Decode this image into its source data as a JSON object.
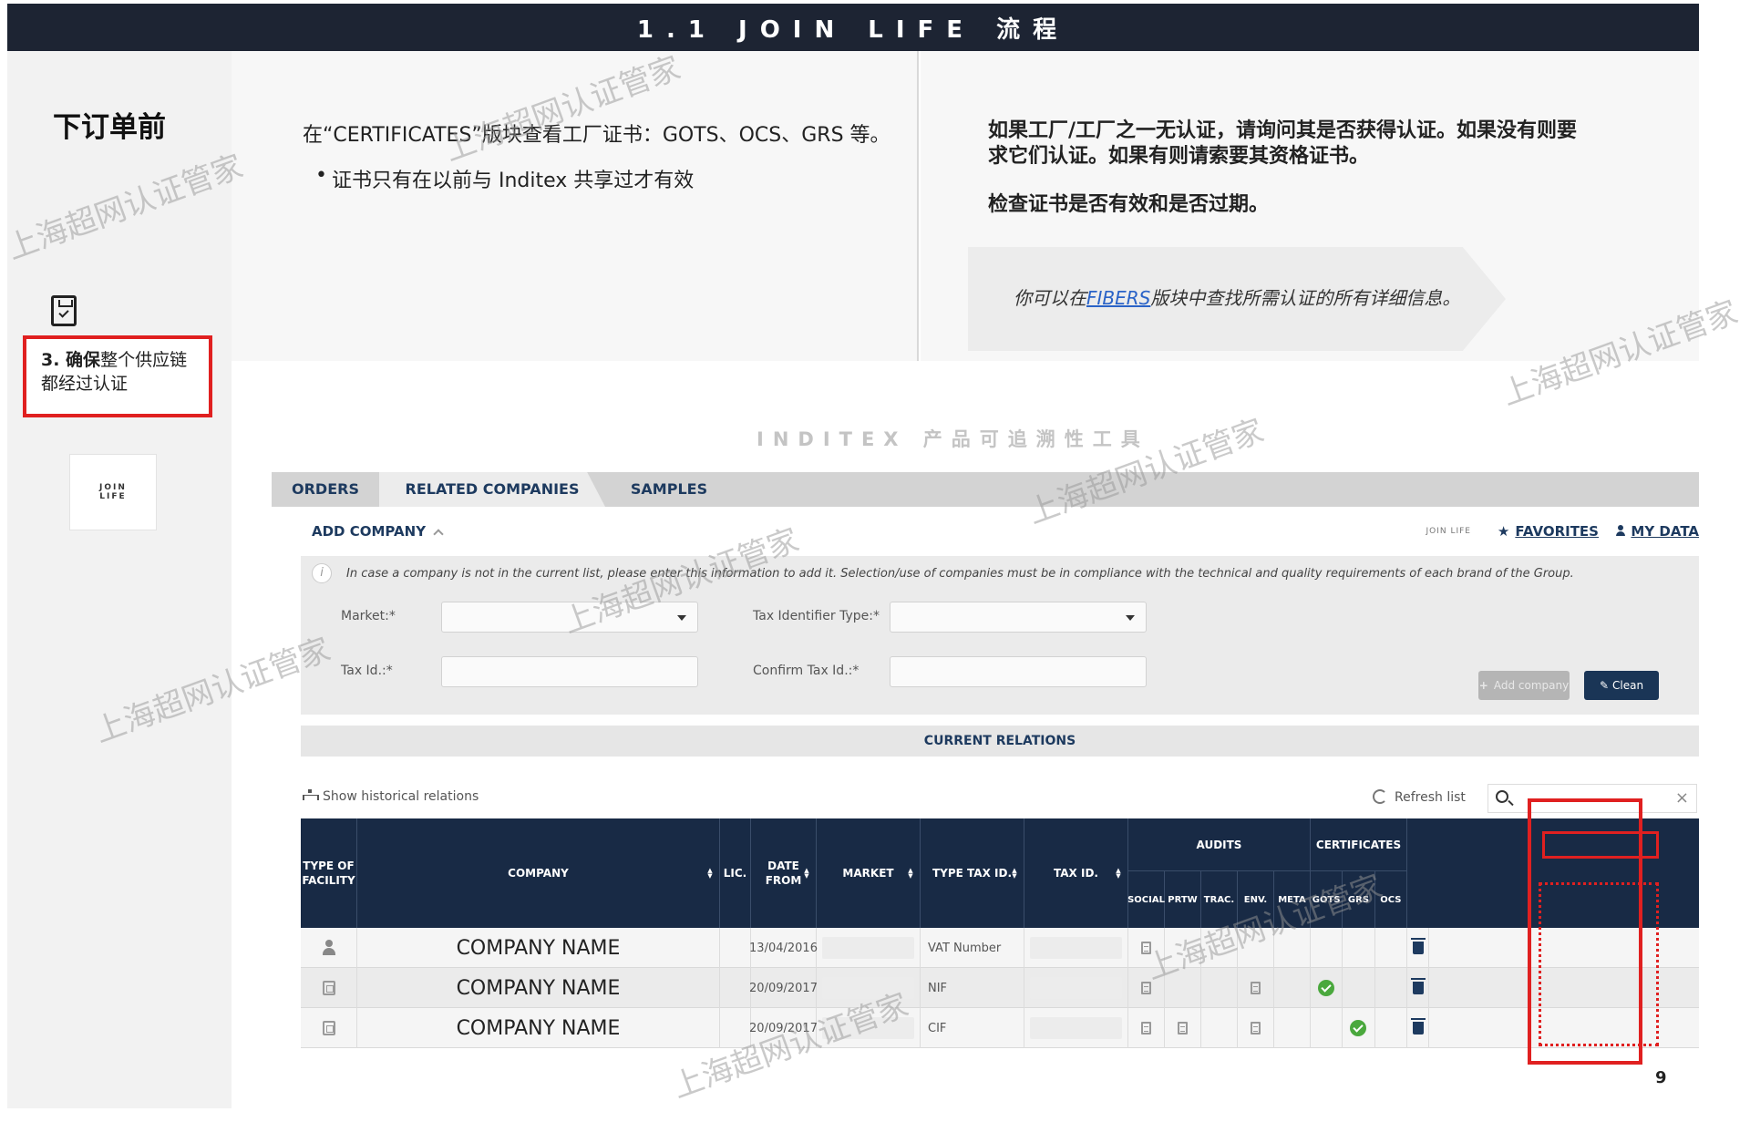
{
  "header": {
    "title": "1.1 JOIN LIFE 流程"
  },
  "left": {
    "heading": "下订单前",
    "step_bold": "3. 确保",
    "step_rest": "整个供应链都经过认证",
    "logo_text": "JOIN LIFE"
  },
  "info_left": {
    "line1": "在“CERTIFICATES”版块查看工厂证书：GOTS、OCS、GRS 等。",
    "line2": "证书只有在以前与 Inditex 共享过才有效"
  },
  "info_right": {
    "line1": "如果工厂/工厂之一无认证，请询问其是否获得认证。如果没有则要求它们认证。如果有则请索要其资格证书。",
    "line2": "检查证书是否有效和是否过期。",
    "callout_prefix": "你可以在",
    "callout_link": "FIBERS",
    "callout_suffix": "版块中查找所需认证的所有详细信息。"
  },
  "app_caption": "INDITEX 产品可追溯性工具",
  "tabs": [
    {
      "label": "ORDERS"
    },
    {
      "label": "RELATED COMPANIES"
    },
    {
      "label": "SAMPLES"
    }
  ],
  "toolbar": {
    "add_company": "ADD COMPANY",
    "mini_logo": "JOIN LIFE",
    "favorites": "FAVORITES",
    "my_data": "MY DATA"
  },
  "form": {
    "note": "In case a company is not in the current list, please enter this information to add it. Selection/use of companies must be in compliance with the technical and quality requirements of each brand of the Group.",
    "market_label": "Market:*",
    "tax_type_label": "Tax Identifier Type:*",
    "tax_id_label": "Tax Id.:*",
    "confirm_tax_label": "Confirm Tax Id.:*",
    "add_button": "Add company",
    "clean_button": "Clean"
  },
  "current_relations": "CURRENT RELATIONS",
  "list_tools": {
    "show_historical": "Show historical relations",
    "refresh": "Refresh list"
  },
  "grid": {
    "headers": {
      "type": "TYPE OF FACILITY",
      "company": "COMPANY",
      "lic": "LIC.",
      "date": "DATE FROM",
      "market": "MARKET",
      "type_tax": "TYPE TAX ID.",
      "tax": "TAX ID.",
      "audits": "AUDITS",
      "certificates": "CERTIFICATES"
    },
    "audit_cols": [
      "SOCIAL",
      "PRTW",
      "TRAC.",
      "ENV.",
      "META"
    ],
    "cert_cols": [
      "GOTS",
      "GRS",
      "OCS"
    ],
    "rows": [
      {
        "type": "person",
        "company": "COMPANY NAME",
        "date": "13/04/2016",
        "type_tax": "VAT Number",
        "audits": [
          1,
          0,
          0,
          0,
          0
        ],
        "certs": [
          0,
          0,
          0
        ]
      },
      {
        "type": "factory",
        "company": "COMPANY NAME",
        "date": "20/09/2017",
        "type_tax": "NIF",
        "audits": [
          1,
          0,
          0,
          1,
          0
        ],
        "certs": [
          1,
          0,
          0
        ]
      },
      {
        "type": "factory",
        "company": "COMPANY NAME",
        "date": "20/09/2017",
        "type_tax": "CIF",
        "audits": [
          1,
          1,
          0,
          1,
          0
        ],
        "certs": [
          0,
          1,
          0
        ]
      }
    ]
  },
  "page_number": "9",
  "watermark_text": "上海超网认证管家"
}
